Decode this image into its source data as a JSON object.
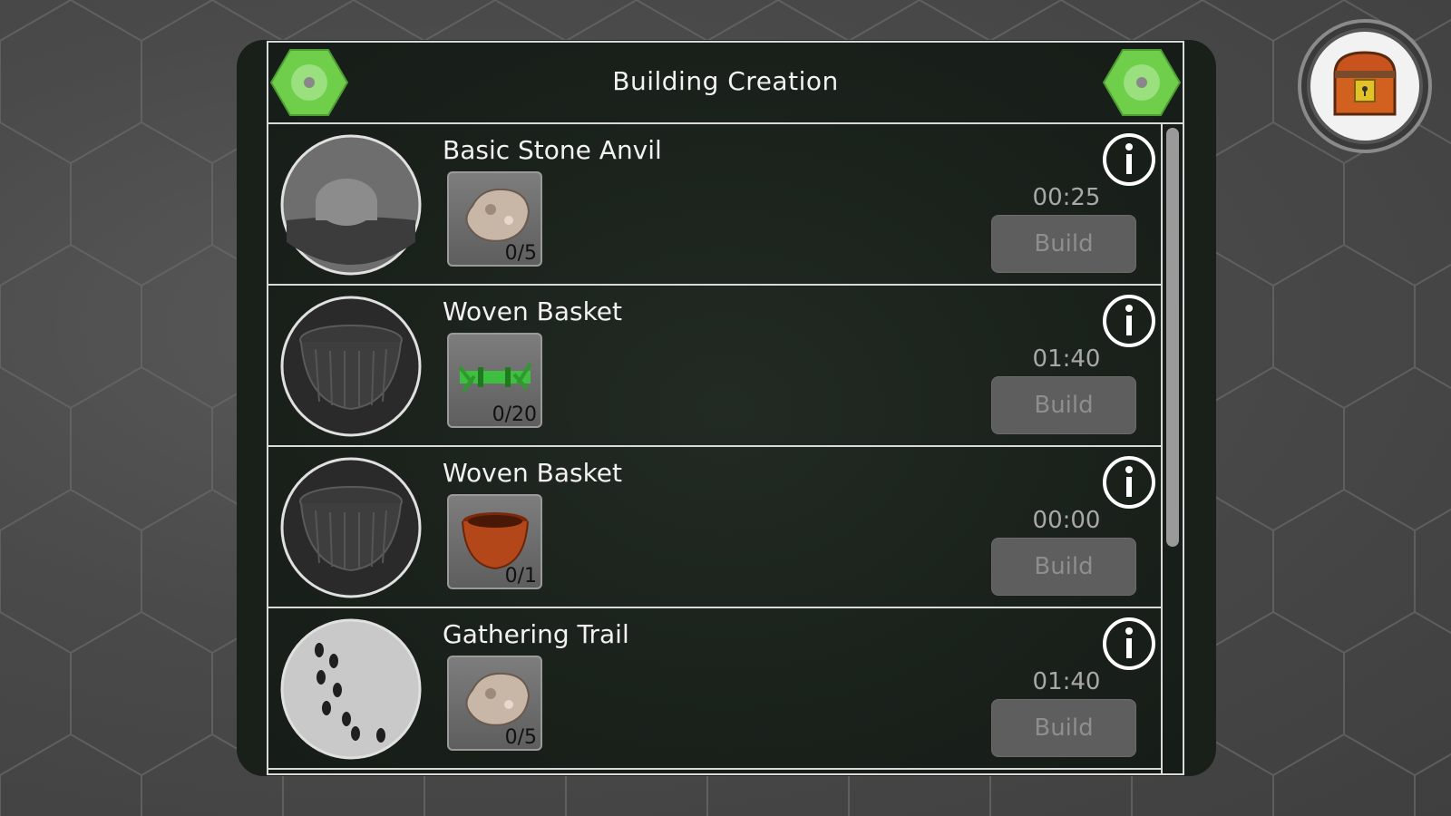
{
  "header": {
    "title": "Building Creation"
  },
  "items": [
    {
      "name": "Basic Stone Anvil",
      "resource_icon": "stone-icon",
      "resource_count": "0/5",
      "timer": "00:25",
      "build_label": "Build",
      "portrait": "anvil-portrait"
    },
    {
      "name": "Woven Basket",
      "resource_icon": "grass-bundle-icon",
      "resource_count": "0/20",
      "timer": "01:40",
      "build_label": "Build",
      "portrait": "basket-portrait"
    },
    {
      "name": "Woven Basket",
      "resource_icon": "basket-icon",
      "resource_count": "0/1",
      "timer": "00:00",
      "build_label": "Build",
      "portrait": "basket-portrait"
    },
    {
      "name": "Gathering Trail",
      "resource_icon": "stone-icon",
      "resource_count": "0/5",
      "timer": "01:40",
      "build_label": "Build",
      "portrait": "footprints-portrait"
    }
  ],
  "colors": {
    "panel": "#182019",
    "border": "#d9d9d9",
    "button_disabled": "#5e5e5e",
    "hex_green": "#6fcf4a"
  }
}
